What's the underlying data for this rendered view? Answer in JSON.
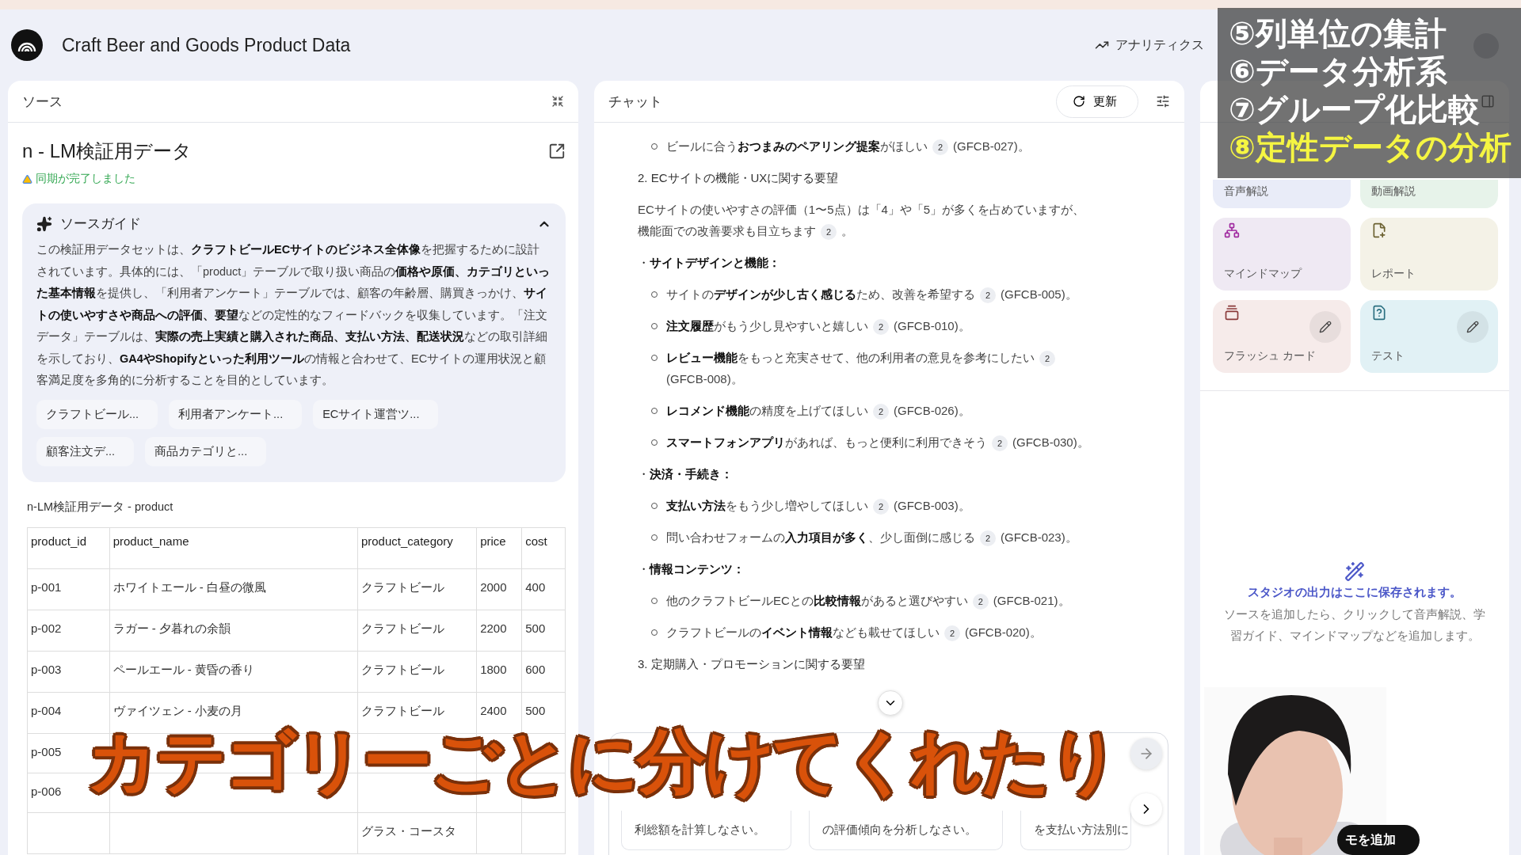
{
  "header": {
    "title": "Craft Beer and Goods Product Data",
    "analytics": "アナリティクス"
  },
  "sources": {
    "title": "ソース",
    "doc_title": "n - LM検証用データ",
    "sync": "同期が完了しました",
    "guide": {
      "title": "ソースガイド",
      "expanded": true,
      "text": "この検証用データセットは、**クラフトビールECサイトのビジネス全体像**を把握するために設計されています。具体的には、「product」テーブルで取り扱い商品の**価格や原価、カテゴリといった基本情報**を提供し、「利用者アンケート」テーブルでは、顧客の年齢層、購買きっかけ、**サイトの使いやすさや商品への評価、要望**などの定性的なフィードバックを収集しています。「注文データ」テーブルは、**実際の売上実績と購入された商品、支払い方法、配送状況**などの取引詳細を示しており、**GA4やShopifyといった利用ツール**の情報と合わせて、ECサイトの運用状況と顧客満足度を多角的に分析することを目的としています。",
      "chips": [
        "クラフトビール...",
        "利用者アンケート...",
        "ECサイト運営ツ...",
        "顧客注文デ...",
        "商品カテゴリと..."
      ]
    },
    "table_caption": "n-LM検証用データ - product",
    "table": {
      "columns": [
        "product_id",
        "product_name",
        "product_category",
        "price",
        "cost"
      ],
      "rows": [
        [
          "p-001",
          "ホワイトエール - 白昼の微風",
          "クラフトビール",
          "2000",
          "400"
        ],
        [
          "p-002",
          "ラガー - 夕暮れの余韻",
          "クラフトビール",
          "2200",
          "500"
        ],
        [
          "p-003",
          "ペールエール - 黄昏の香り",
          "クラフトビール",
          "1800",
          "600"
        ],
        [
          "p-004",
          "ヴァイツェン - 小麦の月",
          "クラフトビール",
          "2400",
          "500"
        ],
        [
          "p-005",
          "",
          "",
          "",
          ""
        ],
        [
          "p-006",
          "",
          "",
          "",
          ""
        ],
        [
          "",
          "",
          "グラス・コースタ",
          "",
          ""
        ]
      ]
    }
  },
  "chat": {
    "title": "チャット",
    "refresh": "更新",
    "items": [
      {
        "kind": "bullet",
        "text": "ビールに合う**おつまみのペアリング提案**がほしい",
        "cite": "2",
        "after": "(GFCB-027)。"
      },
      {
        "kind": "heading",
        "text": "2. ECサイトの機能・UXに関する要望"
      },
      {
        "kind": "para",
        "text": "ECサイトの使いやすさの評価（1〜5点）は「4」や「5」が多くを占めていますが、機能面での改善要求も目立ちます",
        "cite": "2",
        "after": "。"
      },
      {
        "kind": "section",
        "text": "・**サイトデザインと機能：**"
      },
      {
        "kind": "bullet",
        "text": "サイトの**デザインが少し古く感じる**ため、改善を希望する",
        "cite": "2",
        "after": "(GFCB-005)。"
      },
      {
        "kind": "bullet",
        "text": "**注文履歴**がもう少し見やすいと嬉しい",
        "cite": "2",
        "after": "(GFCB-010)。"
      },
      {
        "kind": "bullet",
        "text": "**レビュー機能**をもっと充実させて、他の利用者の意見を参考にしたい",
        "cite": "2",
        "after": "(GFCB-008)。"
      },
      {
        "kind": "bullet",
        "text": "**レコメンド機能**の精度を上げてほしい",
        "cite": "2",
        "after": "(GFCB-026)。"
      },
      {
        "kind": "bullet",
        "text": "**スマートフォンアプリ**があれば、もっと便利に利用できそう",
        "cite": "2",
        "after": "(GFCB-030)。"
      },
      {
        "kind": "section",
        "text": "・**決済・手続き：**"
      },
      {
        "kind": "bullet",
        "text": "**支払い方法**をもう少し増やしてほしい",
        "cite": "2",
        "after": "(GFCB-003)。"
      },
      {
        "kind": "bullet",
        "text": "問い合わせフォームの**入力項目が多く**、少し面倒に感じる",
        "cite": "2",
        "after": "(GFCB-023)。"
      },
      {
        "kind": "section",
        "text": "・**情報コンテンツ：**"
      },
      {
        "kind": "bullet",
        "text": "他のクラフトビールECとの**比較情報**があると選びやすい",
        "cite": "2",
        "after": "(GFCB-021)。"
      },
      {
        "kind": "bullet",
        "text": "クラフトビールの**イベント情報**なども載せてほしい",
        "cite": "2",
        "after": "(GFCB-020)。"
      },
      {
        "kind": "heading",
        "text": "3. 定期購入・プロモーションに関する要望"
      }
    ],
    "suggestions": [
      "利総額を計算しなさい。",
      "の評価傾向を分析しなさい。",
      "を支払い方法別に"
    ]
  },
  "studio": {
    "tiles": [
      {
        "kind": "audio",
        "label": "音声解説",
        "color": "#e9ecf8",
        "edit": false
      },
      {
        "kind": "video",
        "label": "動画解説",
        "color": "#e7f3ea",
        "edit": false
      },
      {
        "kind": "mindmap",
        "label": "マインドマップ",
        "color": "#efe9f3",
        "edit": false
      },
      {
        "kind": "report",
        "label": "レポート",
        "color": "#f4f2e7",
        "edit": false
      },
      {
        "kind": "flashcards",
        "label": "フラッシュ カード",
        "color": "#f6ebea",
        "edit": true
      },
      {
        "kind": "quiz",
        "label": "テスト",
        "color": "#e1f1f5",
        "edit": true
      }
    ],
    "empty_title": "スタジオの出力はここに保存されます。",
    "empty_text": "ソースを追加したら、クリックして音声解説、学習ガイド、マインドマップなどを追加します。"
  },
  "overlay": {
    "lines": [
      {
        "text": "⑤列単位の集計",
        "highlight": false
      },
      {
        "text": "⑥データ分析系",
        "highlight": false
      },
      {
        "text": "⑦グループ化比較",
        "highlight": false
      },
      {
        "text": "⑧定性データの分析",
        "highlight": true
      }
    ]
  },
  "caption": "カテゴリーごとに分けてくれたり",
  "memo_button": "モを追加"
}
